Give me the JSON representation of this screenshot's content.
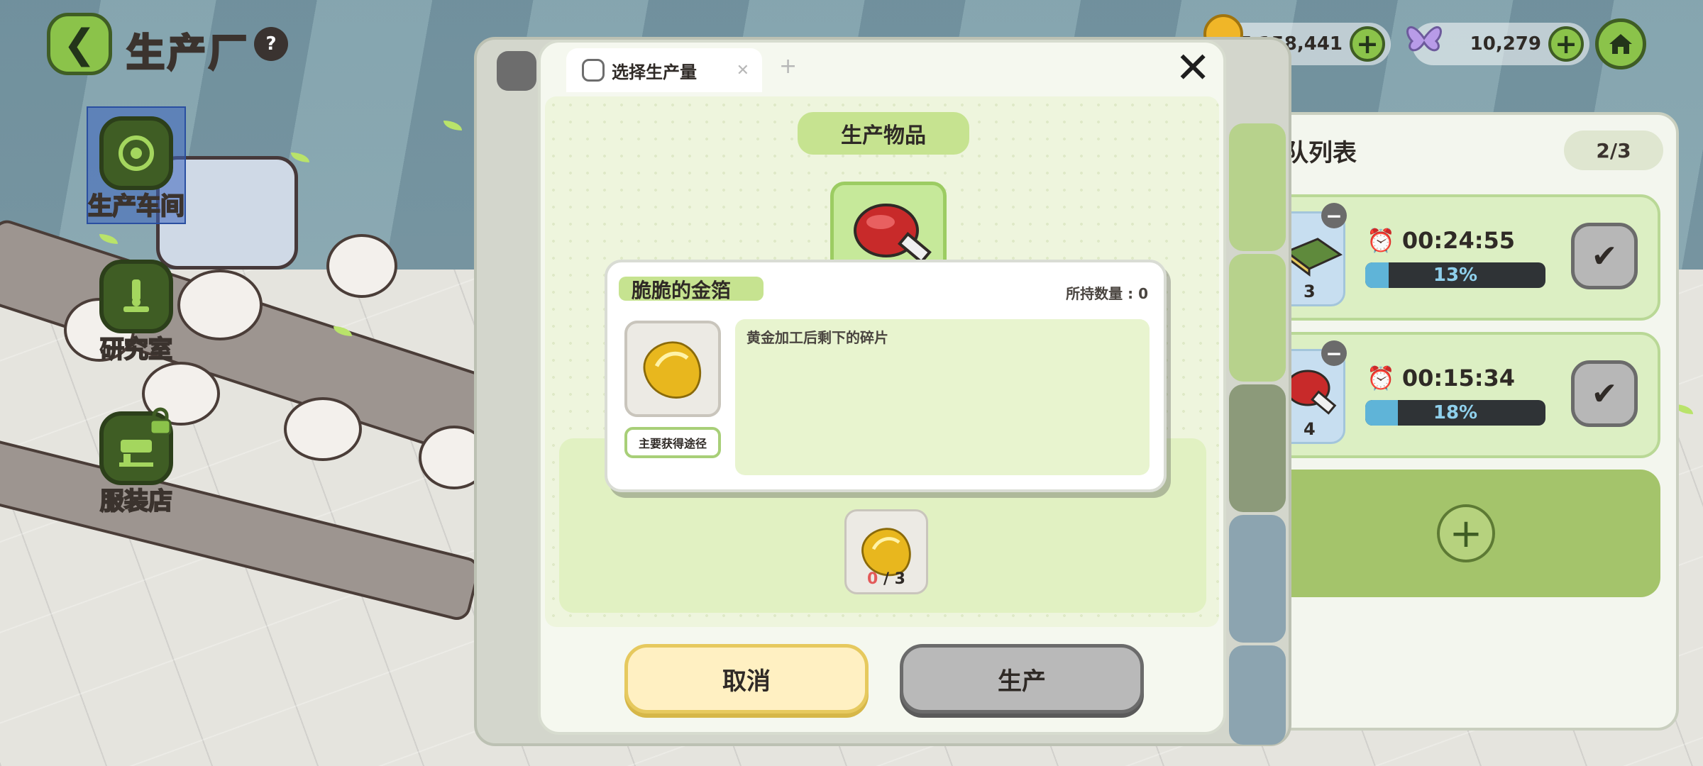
{
  "header": {
    "title": "生产厂",
    "help_label": "?"
  },
  "currencies": {
    "gold": "7,158,441",
    "gems": "10,279",
    "plus_label": "+"
  },
  "nav": {
    "items": [
      {
        "label": "生产车间",
        "active": true
      },
      {
        "label": "研究室",
        "active": false
      },
      {
        "label": "服装店",
        "active": false,
        "locked": true
      }
    ]
  },
  "queue": {
    "title": "队列表",
    "count": "2/3",
    "items": [
      {
        "qty": "3",
        "time": "00:24:55",
        "progress_pct": 13,
        "progress_label": "13%"
      },
      {
        "qty": "4",
        "time": "00:15:34",
        "progress_pct": 18,
        "progress_label": "18%"
      }
    ],
    "add_label": "+"
  },
  "modal": {
    "tab_label": "选择生产量",
    "section_title": "生产物品",
    "material": {
      "have": "0",
      "need": "3"
    },
    "cancel_label": "取消",
    "produce_label": "生产"
  },
  "tooltip": {
    "item_name": "脆脆的金箔",
    "held_label": "所持数量 : 0",
    "description": "黄金加工后剩下的碎片",
    "source_button": "主要获得途径"
  },
  "colors": {
    "accent_green": "#8bc34a",
    "panel_bg": "#f5f8ef",
    "cancel_yellow": "#fff0c2",
    "progress_blue": "#5fb4d8"
  }
}
